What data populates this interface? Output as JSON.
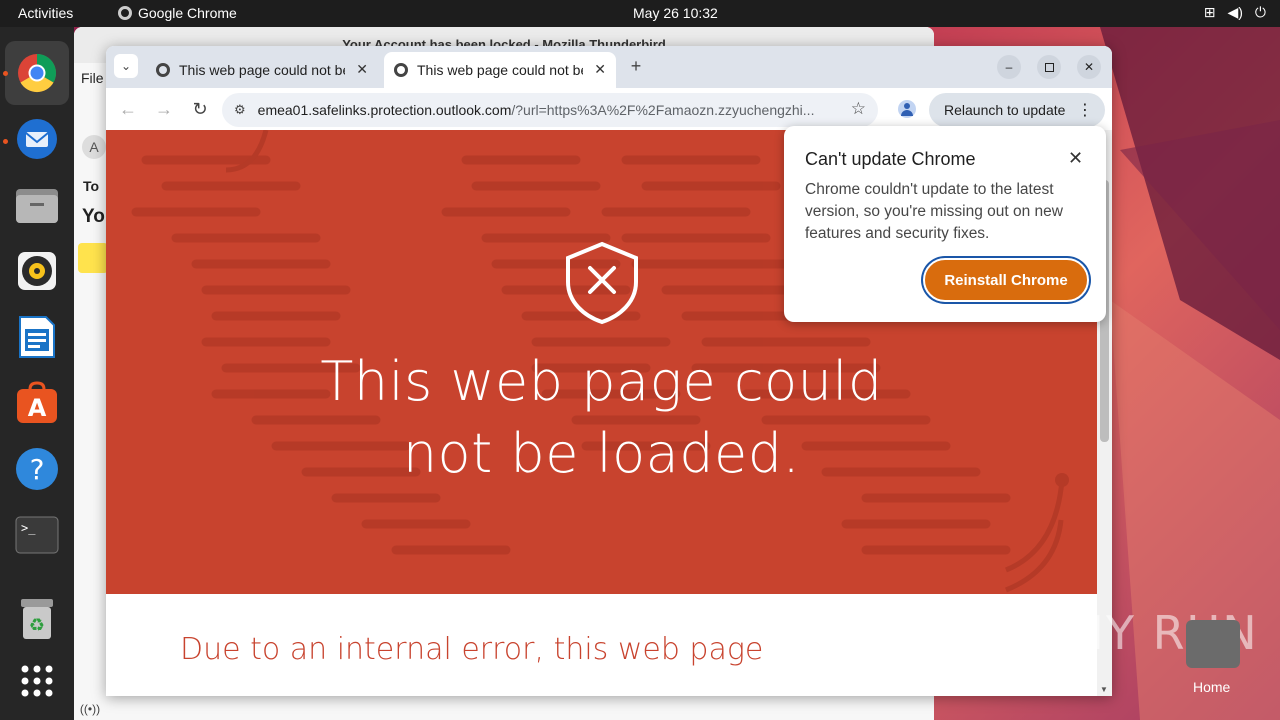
{
  "topbar": {
    "activities": "Activities",
    "app_name": "Google Chrome",
    "clock": "May 26  10:32"
  },
  "dock": {
    "items": [
      "chrome-icon",
      "thunderbird-icon",
      "files-icon",
      "rhythmbox-icon",
      "writer-icon",
      "app-center-icon",
      "help-icon",
      "terminal-icon",
      "trash-icon",
      "apps-grid-icon"
    ]
  },
  "thunderbird": {
    "title": "Your Account has been locked - Mozilla Thunderbird",
    "menu_file": "File",
    "to_label": "To",
    "subject_fragment": "Yo",
    "avatar_letter": "A"
  },
  "chrome": {
    "tabs": [
      {
        "title": "This web page could not be loaded"
      },
      {
        "title": "This web page could not be loaded"
      }
    ],
    "omnibox": {
      "host": "emea01.safelinks.protection.outlook.com",
      "rest": "/?url=https%3A%2F%2Famaozn.zzyuchengzhi..."
    },
    "relaunch_label": "Relaunch to update"
  },
  "page": {
    "hero_title_line1": "This web page could",
    "hero_title_line2": "not be loaded.",
    "sub_heading": "Due to an internal error, this web page",
    "hero_color": "#c8432e"
  },
  "popup": {
    "title": "Can't update Chrome",
    "body": "Chrome couldn't update to the latest version, so you're missing out on new features and security fixes.",
    "button": "Reinstall Chrome",
    "button_color": "#d96c0d"
  },
  "desktop": {
    "watermark": "ANY RUN",
    "home_label": "Home"
  }
}
